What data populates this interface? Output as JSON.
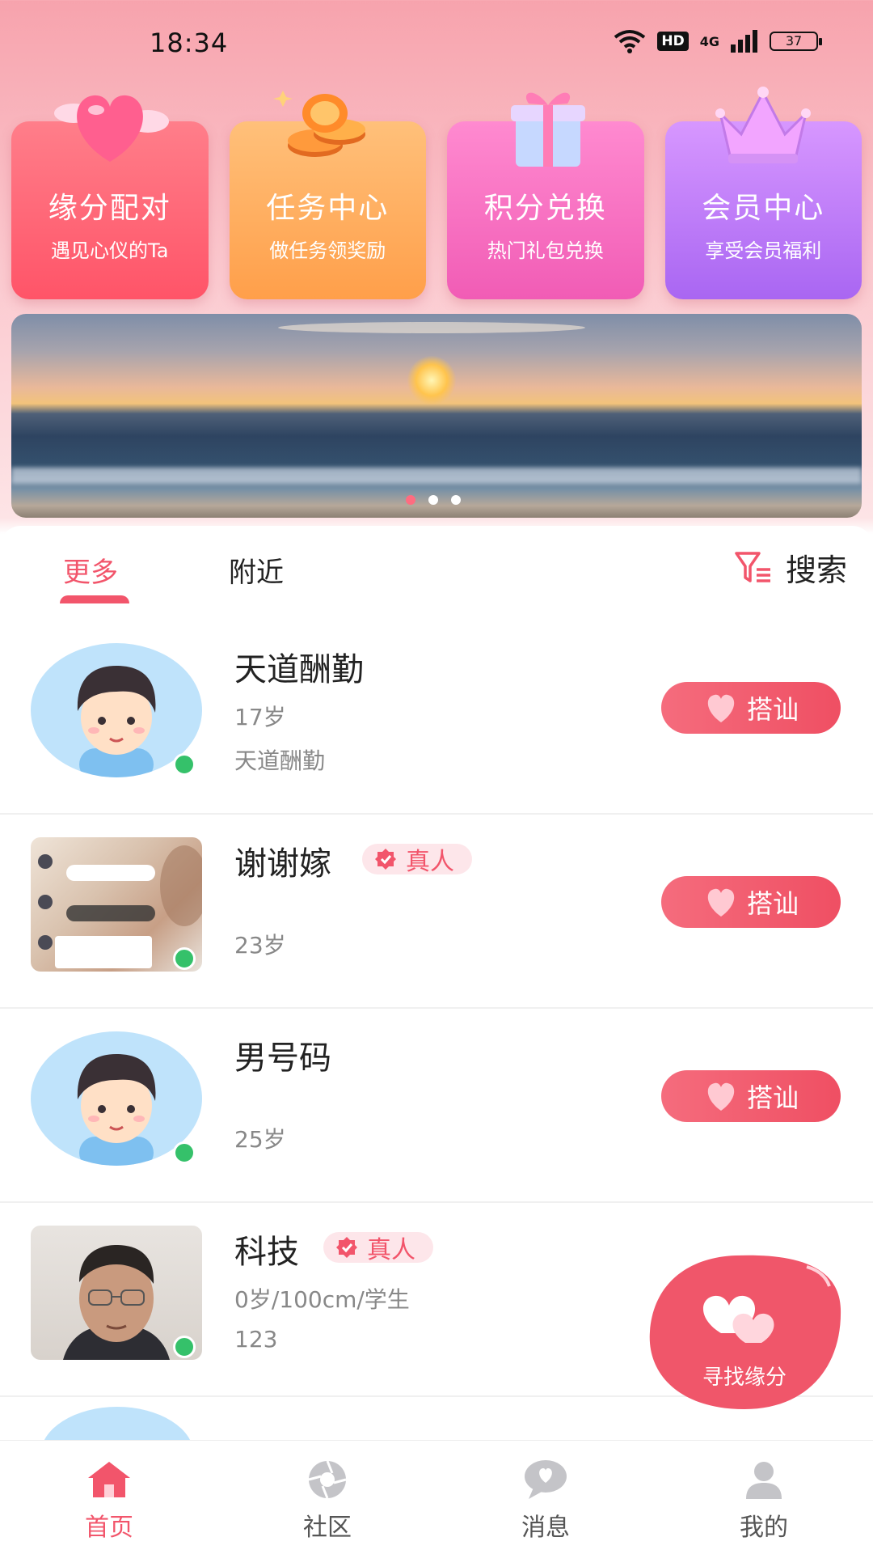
{
  "status_bar": {
    "time": "18:34",
    "hd": "HD",
    "network": "4G",
    "battery": "37"
  },
  "features": [
    {
      "title": "缘分配对",
      "subtitle": "遇见心仪的Ta",
      "icon": "heart-icon"
    },
    {
      "title": "任务中心",
      "subtitle": "做任务领奖励",
      "icon": "coins-icon"
    },
    {
      "title": "积分兑换",
      "subtitle": "热门礼包兑换",
      "icon": "gift-icon"
    },
    {
      "title": "会员中心",
      "subtitle": "享受会员福利",
      "icon": "crown-icon"
    }
  ],
  "tabs": {
    "more": "更多",
    "nearby": "附近"
  },
  "search_label": "搜索",
  "users": [
    {
      "name": "天道酬勤",
      "line1": "17岁",
      "line2": "天道酬勤",
      "verified": false,
      "button": "搭讪"
    },
    {
      "name": "谢谢嫁",
      "line1": "",
      "line2": "23岁",
      "verified": true,
      "badge": "真人",
      "button": "搭讪"
    },
    {
      "name": "男号码",
      "line1": "",
      "line2": "25岁",
      "verified": false,
      "button": "搭讪"
    },
    {
      "name": "科技",
      "line1": "0岁/100cm/学生",
      "line2": "123",
      "verified": true,
      "badge": "真人",
      "button": "搭讪"
    }
  ],
  "fab_label": "寻找缘分",
  "bottom_nav": [
    {
      "label": "首页",
      "icon": "home-icon",
      "active": true
    },
    {
      "label": "社区",
      "icon": "aperture-icon",
      "active": false
    },
    {
      "label": "消息",
      "icon": "chat-icon",
      "active": false
    },
    {
      "label": "我的",
      "icon": "user-icon",
      "active": false
    }
  ],
  "colors": {
    "accent": "#f2556b",
    "online": "#35c16a"
  }
}
